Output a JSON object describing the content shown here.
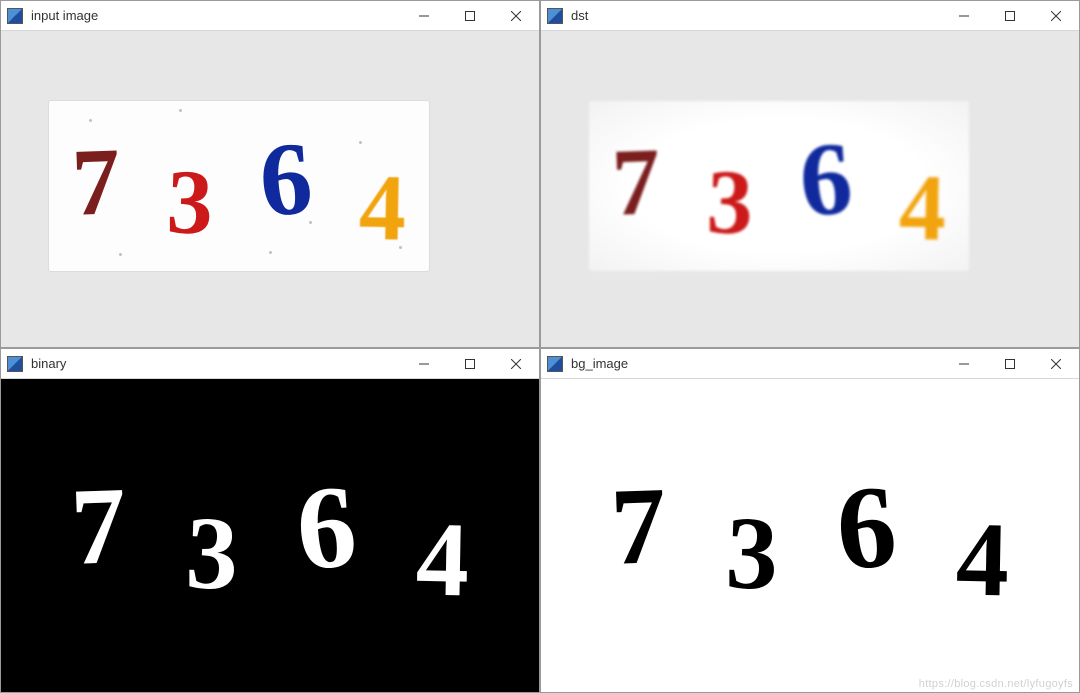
{
  "windows": {
    "input": {
      "title": "input image",
      "digits": {
        "d1": "7",
        "d2": "3",
        "d3": "6",
        "d4": "4"
      }
    },
    "dst": {
      "title": "dst",
      "digits": {
        "d1": "7",
        "d2": "3",
        "d3": "6",
        "d4": "4"
      }
    },
    "binary": {
      "title": "binary",
      "digits": {
        "d1": "7",
        "d2": "3",
        "d3": "6",
        "d4": "4"
      }
    },
    "bg": {
      "title": "bg_image",
      "digits": {
        "d1": "7",
        "d2": "3",
        "d3": "6",
        "d4": "4"
      }
    }
  },
  "colors": {
    "digit7": "#7a1e1e",
    "digit3": "#cc1a1a",
    "digit6": "#102a9e",
    "digit4": "#f2a40e"
  },
  "watermark": "https://blog.csdn.net/lyfugoyfs"
}
